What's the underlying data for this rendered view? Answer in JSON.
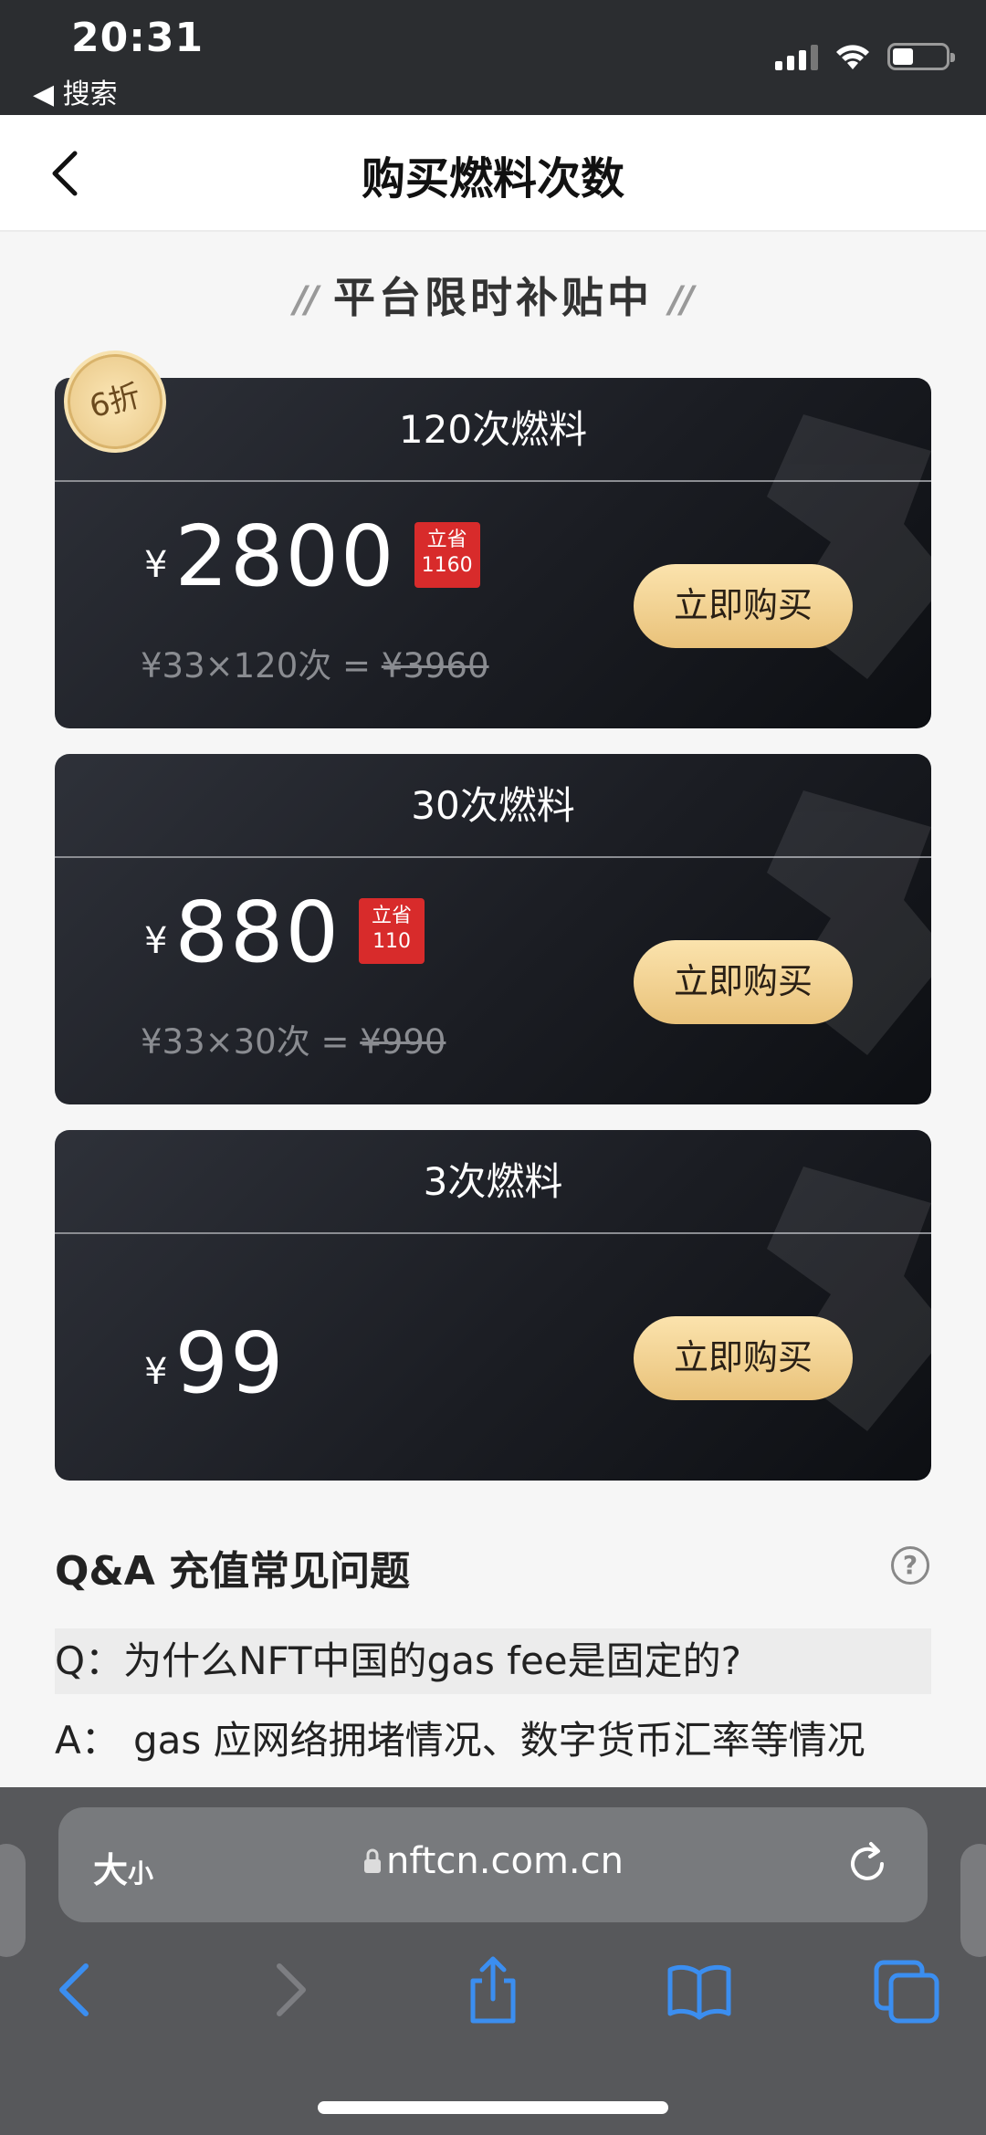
{
  "status": {
    "time": "20:31",
    "back_label": "◀ 搜索"
  },
  "nav": {
    "title": "购买燃料次数"
  },
  "subtitle": {
    "left_deco": "//",
    "text": "平台限时补贴中",
    "right_deco": "//"
  },
  "discount_badge": "6折",
  "cards": [
    {
      "title": "120次燃料",
      "currency": "¥",
      "price": "2800",
      "save_top": "立省",
      "save_amount": "1160",
      "formula_text": "¥33×120次 = ",
      "formula_original": "¥3960",
      "buy_label": "立即购买"
    },
    {
      "title": "30次燃料",
      "currency": "¥",
      "price": "880",
      "save_top": "立省",
      "save_amount": "110",
      "formula_text": "¥33×30次 = ",
      "formula_original": "¥990",
      "buy_label": "立即购买"
    },
    {
      "title": "3次燃料",
      "currency": "¥",
      "price": "99",
      "buy_label": "立即购买"
    }
  ],
  "qa": {
    "title": "Q&A  充值常见问题",
    "help_icon": "?",
    "q_label": "Q：",
    "question": "为什么NFT中国的gas fee是固定的?",
    "a_label": "A：",
    "answer": "gas 应网络拥堵情况、数字货币汇率等情况"
  },
  "browser": {
    "text_size_label": "大",
    "text_size_small": "小",
    "url": "nftcn.com.cn"
  },
  "colors": {
    "card_bg": "#1b1d23",
    "button_gold": "#f3d393",
    "save_red": "#d82b2b",
    "ios_blue": "#3b8ef0"
  }
}
